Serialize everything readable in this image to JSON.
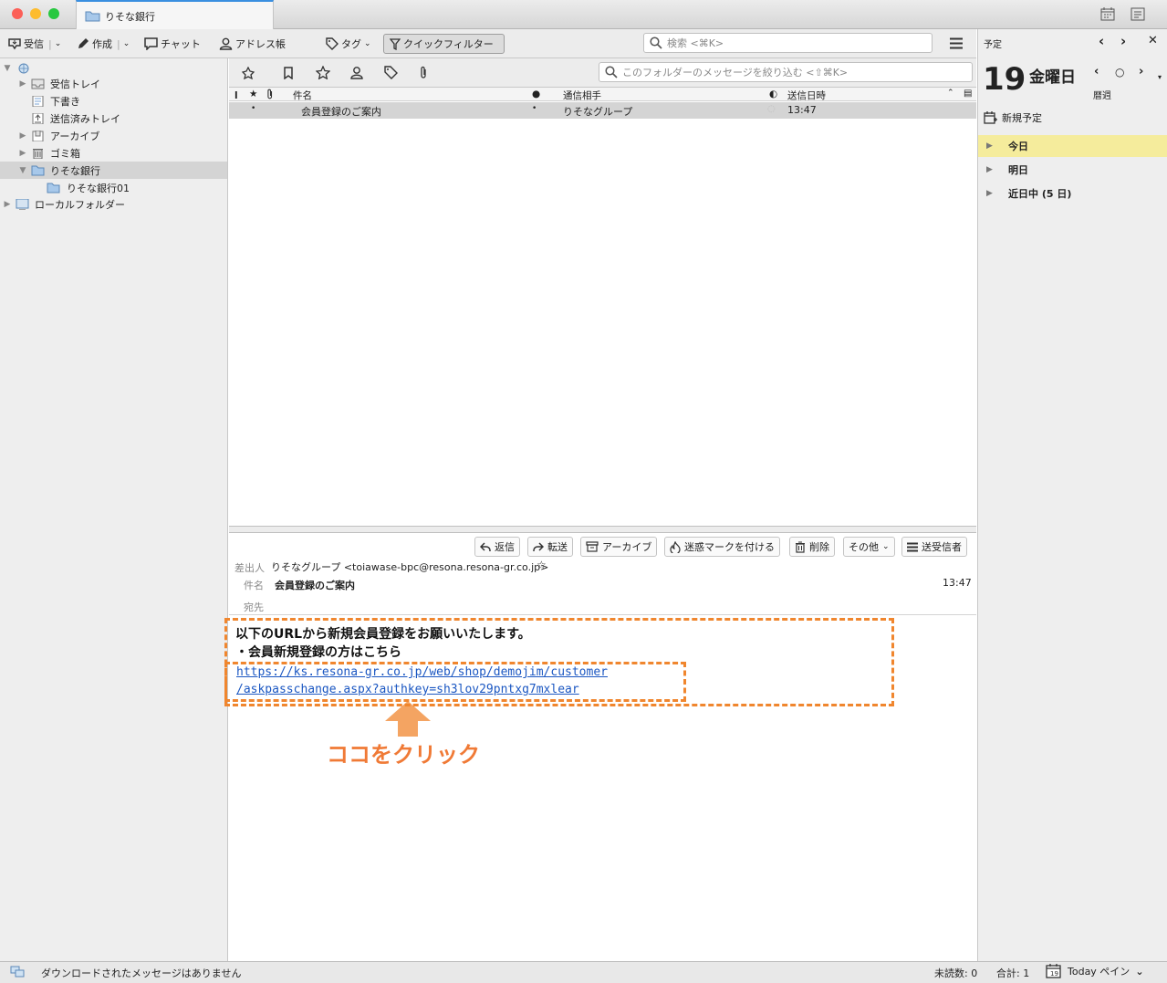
{
  "window": {
    "tab_title": "りそな銀行"
  },
  "toolbar": {
    "get_mail": "受信",
    "write": "作成",
    "chat": "チャット",
    "address_book": "アドレス帳",
    "tag": "タグ",
    "quick_filter": "クイックフィルター",
    "search_placeholder": "検索 <⌘K>"
  },
  "folders": {
    "items": [
      {
        "label": "受信トレイ"
      },
      {
        "label": "下書き"
      },
      {
        "label": "送信済みトレイ"
      },
      {
        "label": "アーカイブ"
      },
      {
        "label": "ゴミ箱"
      },
      {
        "label": "りそな銀行"
      },
      {
        "label": "りそな銀行01"
      },
      {
        "label": "ローカルフォルダー"
      }
    ]
  },
  "thread_pane": {
    "filter_placeholder": "このフォルダーのメッセージを絞り込む <⇧⌘K>",
    "columns": {
      "subject": "件名",
      "correspondent": "通信相手",
      "date": "送信日時"
    },
    "messages": [
      {
        "subject": "会員登録のご案内",
        "correspondent": "りそなグループ",
        "date": "13:47"
      }
    ]
  },
  "message_header": {
    "buttons": {
      "reply": "返信",
      "forward": "転送",
      "archive": "アーカイブ",
      "junk": "迷惑マークを付ける",
      "delete": "削除",
      "other": "その他",
      "sender": "送受信者"
    },
    "from_label": "差出人",
    "from_value": "りそなグループ <toiawase-bpc@resona.resona-gr.co.jp>",
    "subject_label": "件名",
    "subject_value": "会員登録のご案内",
    "time": "13:47",
    "to_label": "宛先"
  },
  "message_body": {
    "line1": "以下のURLから新規会員登録をお願いいたします。",
    "line2": "・会員新規登録の方はこちら",
    "link_line1": "https://ks.resona-gr.co.jp/web/shop/demojim/customer",
    "link_line2": "/askpasschange.aspx?authkey=sh3lov29pntxg7mxlear",
    "annotation": "ココをクリック",
    "annotation_color": "#f07a36"
  },
  "today_pane": {
    "header_label": "予定",
    "day_number": "19",
    "weekday": "金曜日",
    "week_label": "暦週",
    "new_event": "新規予定",
    "sections": [
      {
        "label": "今日"
      },
      {
        "label": "明日"
      },
      {
        "label": "近日中 (5 日)"
      }
    ]
  },
  "status_bar": {
    "message": "ダウンロードされたメッセージはありません",
    "unread": "未読数: 0",
    "total": "合計: 1",
    "today_pane_toggle": "Today ペイン"
  }
}
